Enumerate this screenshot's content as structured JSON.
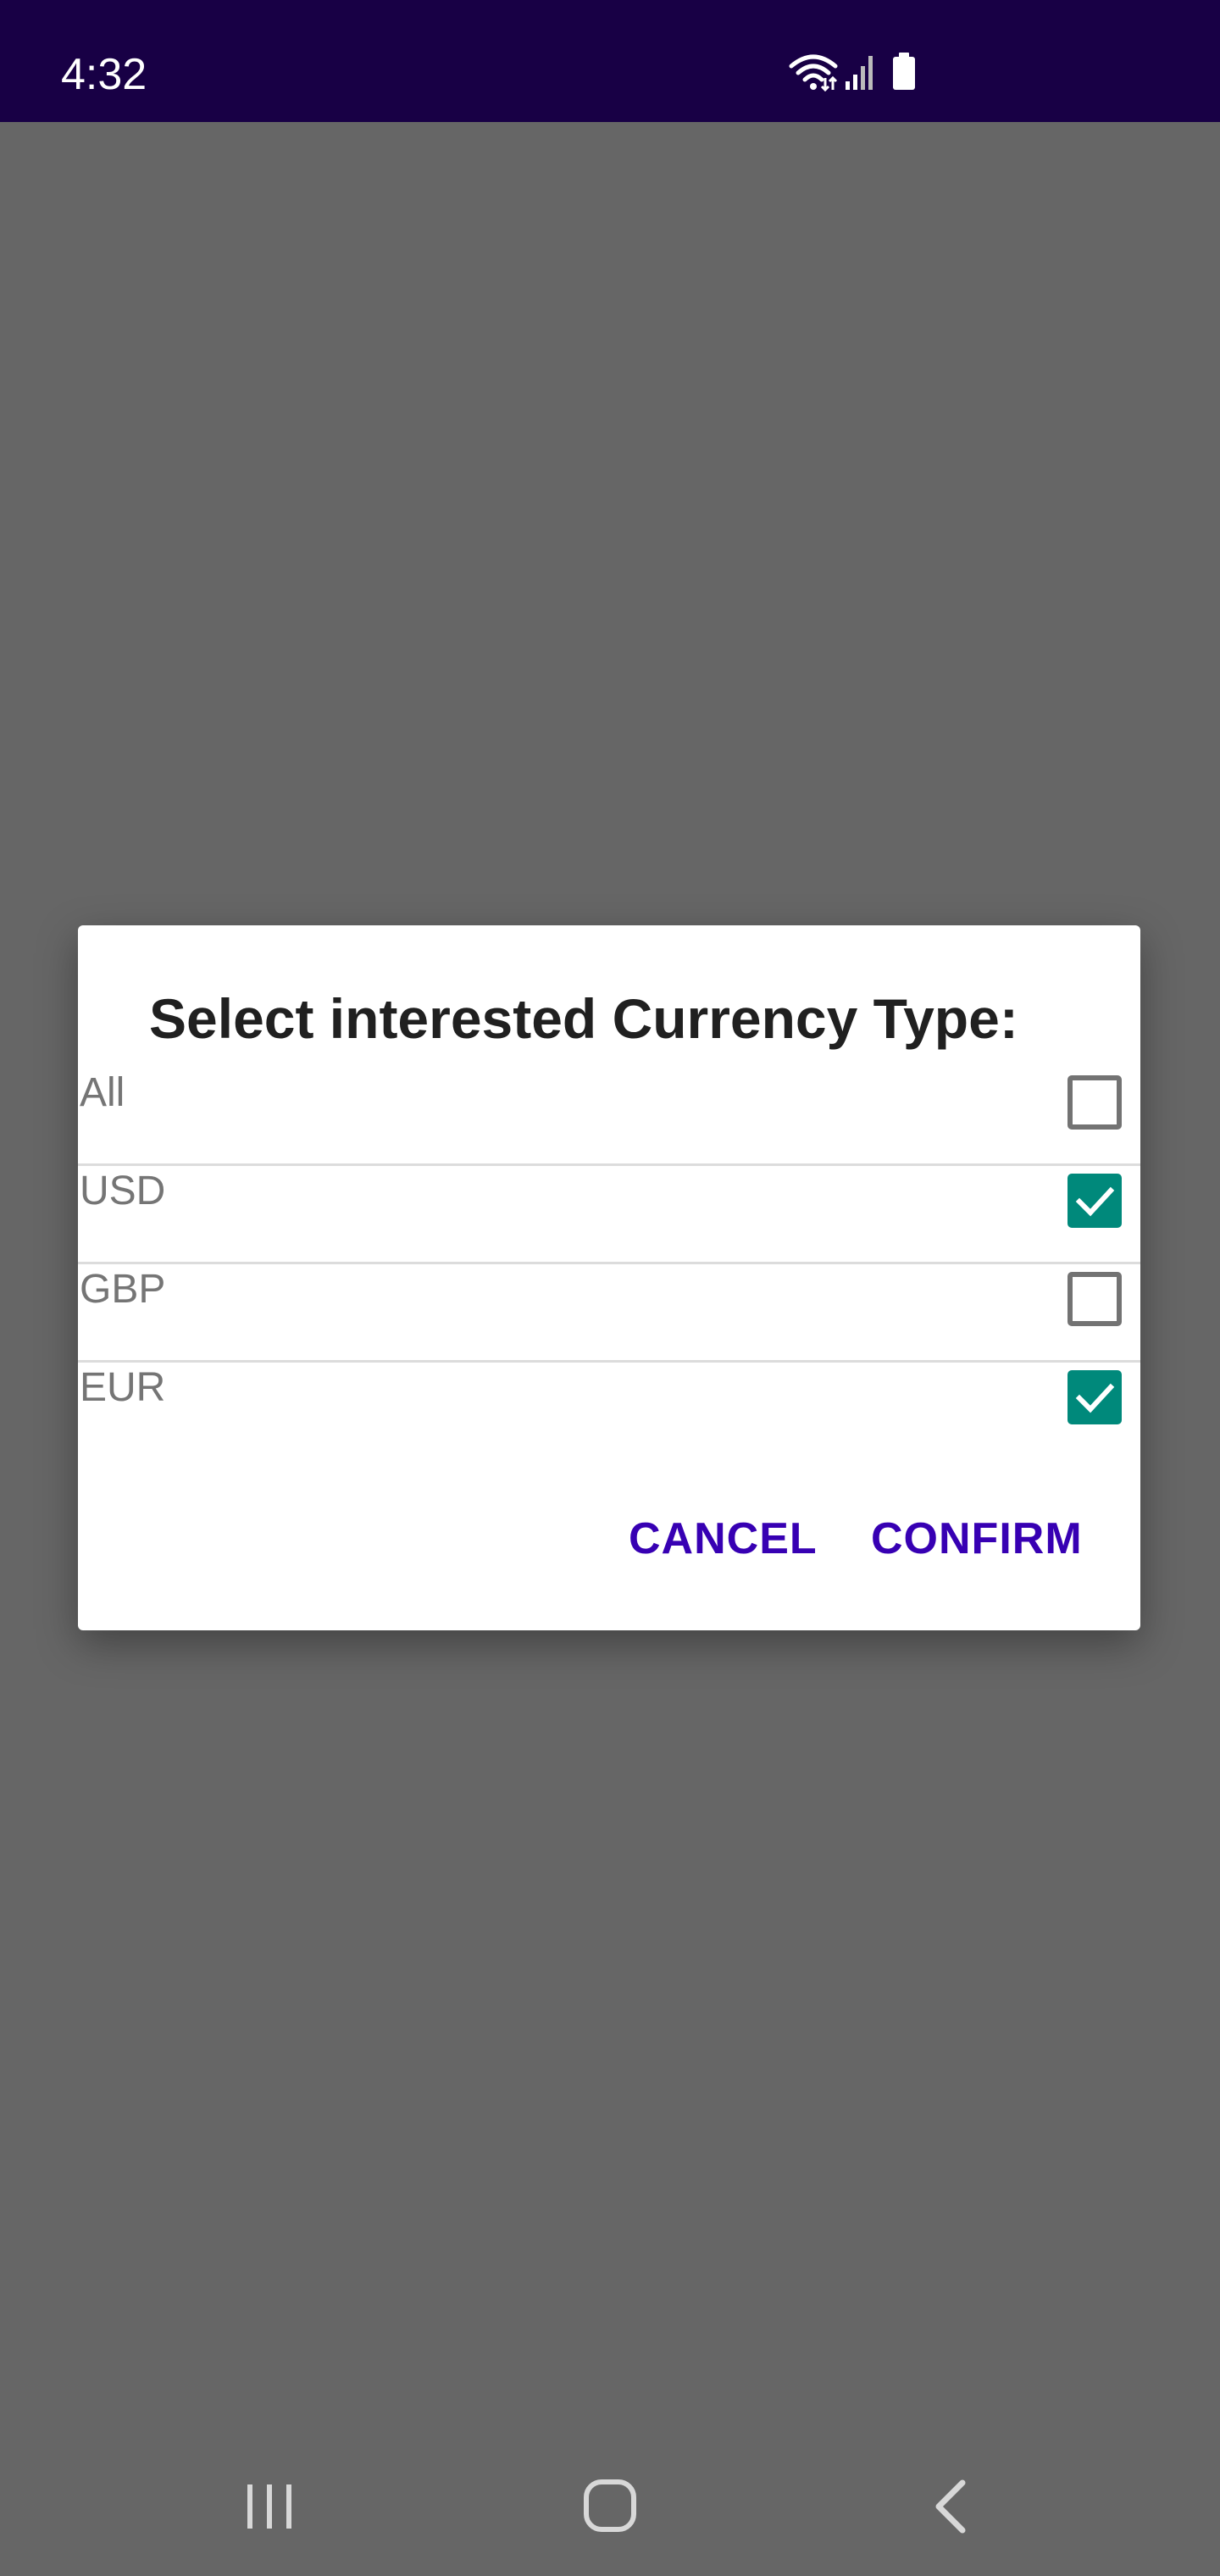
{
  "status_bar": {
    "time": "4:32",
    "icons": [
      "wifi-icon",
      "signal-icon",
      "battery-icon"
    ]
  },
  "dialog": {
    "title": "Select interested Currency Type:",
    "options": [
      {
        "label": "All",
        "checked": false
      },
      {
        "label": "USD",
        "checked": true
      },
      {
        "label": "GBP",
        "checked": false
      },
      {
        "label": "EUR",
        "checked": true
      }
    ],
    "cancel_label": "CANCEL",
    "confirm_label": "CONFIRM"
  },
  "nav_bar": {
    "buttons": [
      "recent-apps-icon",
      "home-icon",
      "back-icon"
    ]
  },
  "colors": {
    "status_bar": "#180045",
    "scrim": "#666666",
    "accent_button": "#3700b3",
    "checkbox_checked": "#00897b",
    "checkbox_unchecked": "#737373",
    "option_text": "#757575"
  }
}
